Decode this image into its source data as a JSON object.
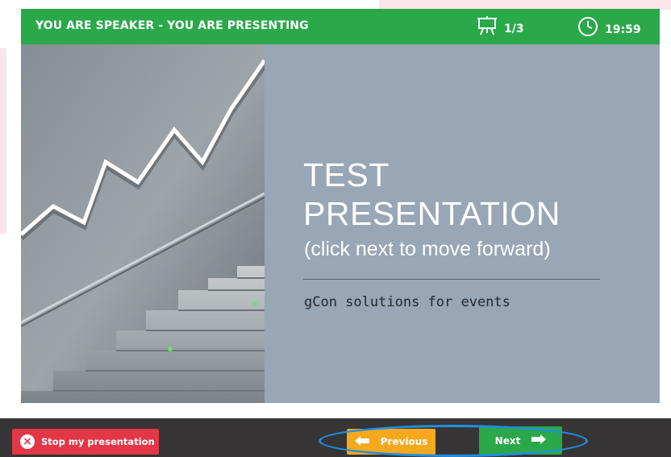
{
  "header": {
    "status_text": "YOU ARE SPEAKER - YOU ARE PRESENTING",
    "slide_counter": "1/3",
    "timer": "19:59"
  },
  "slide": {
    "title_line1": "TEST",
    "title_line2": "PRESENTATION",
    "subtitle": "(click next to move forward)",
    "tagline": "gCon solutions for events",
    "image": "rising-line-over-stairs-photo"
  },
  "controls": {
    "stop_label": "Stop my presentation",
    "previous_label": "Previous",
    "next_label": "Next"
  },
  "colors": {
    "header_green": "#2aa84a",
    "slide_background": "#98a6b5",
    "stop_red": "#e33748",
    "previous_orange": "#f6a81f",
    "next_green": "#2aa84a",
    "bottom_bar": "#363434",
    "highlight_oval": "#1f8fe0"
  },
  "icons": {
    "slide_counter": "presentation-board-icon",
    "timer": "clock-icon",
    "stop": "close-circle-icon",
    "previous": "arrow-left-icon",
    "next": "arrow-right-icon"
  }
}
